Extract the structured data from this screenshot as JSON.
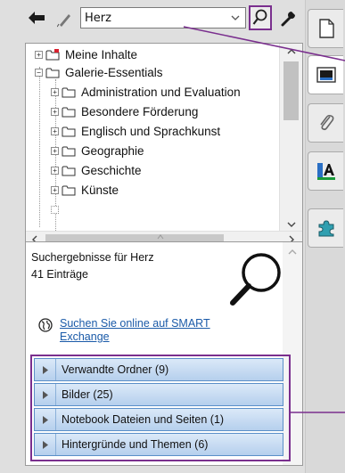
{
  "toolbar": {
    "search_value": "Herz",
    "back_icon": "back-arrow-icon",
    "pen_icon": "pen-icon",
    "search_icon": "magnifier-icon",
    "wrench_icon": "wrench-icon"
  },
  "tree": {
    "items": [
      {
        "label": "Meine Inhalte",
        "level": 0,
        "expander": "+"
      },
      {
        "label": "Galerie-Essentials",
        "level": 0,
        "expander": "−"
      },
      {
        "label": "Administration und Evaluation",
        "level": 1,
        "expander": "+"
      },
      {
        "label": "Besondere Förderung",
        "level": 1,
        "expander": "+"
      },
      {
        "label": "Englisch und Sprachkunst",
        "level": 1,
        "expander": "+"
      },
      {
        "label": "Geographie",
        "level": 1,
        "expander": "+"
      },
      {
        "label": "Geschichte",
        "level": 1,
        "expander": "+"
      },
      {
        "label": "Künste",
        "level": 1,
        "expander": "+"
      }
    ]
  },
  "results": {
    "title": "Suchergebnisse für Herz",
    "count": "41 Einträge",
    "online_link": "Suchen Sie online auf SMART Exchange",
    "categories": [
      {
        "label": "Verwandte Ordner (9)"
      },
      {
        "label": "Bilder (25)"
      },
      {
        "label": "Notebook Dateien und Seiten (1)"
      },
      {
        "label": "Hintergründe und Themen (6)"
      }
    ]
  },
  "tabs": [
    {
      "icon": "page-sorter-icon"
    },
    {
      "icon": "gallery-icon"
    },
    {
      "icon": "attachments-icon"
    },
    {
      "icon": "properties-icon"
    },
    {
      "icon": "addons-icon"
    }
  ],
  "colors": {
    "highlight": "#7a2f8e",
    "category_fill": "#c6daf2",
    "link": "#1a5aa8"
  }
}
